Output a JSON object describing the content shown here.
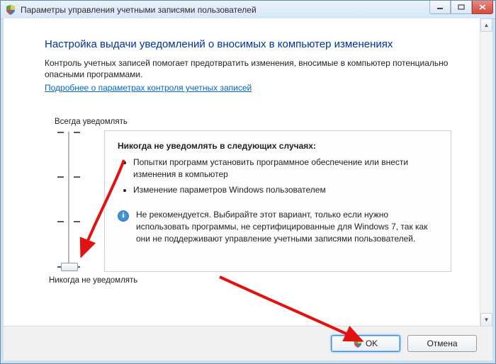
{
  "window": {
    "title": "Параметры управления учетными записями пользователей"
  },
  "heading": "Настройка выдачи уведомлений о вносимых в компьютер изменениях",
  "intro": "Контроль учетных записей помогает предотвратить изменения, вносимые в компьютер потенциально опасными программами.",
  "link": "Подробнее о параметрах контроля учетных записей",
  "slider": {
    "top_label": "Всегда уведомлять",
    "bottom_label": "Никогда не уведомлять",
    "level_count": 4,
    "current_level": 0
  },
  "panel": {
    "title": "Никогда не уведомлять в следующих случаях:",
    "bullets": [
      "Попытки программ установить программное обеспечение или внести изменения в компьютер",
      "Изменение параметров Windows пользователем"
    ],
    "note": "Не рекомендуется. Выбирайте этот вариант, только если нужно использовать программы, не сертифицированные для Windows 7, так как они не поддерживают управление учетными записями пользователей."
  },
  "buttons": {
    "ok": "OK",
    "cancel": "Отмена"
  },
  "icons": {
    "info_glyph": "i"
  }
}
